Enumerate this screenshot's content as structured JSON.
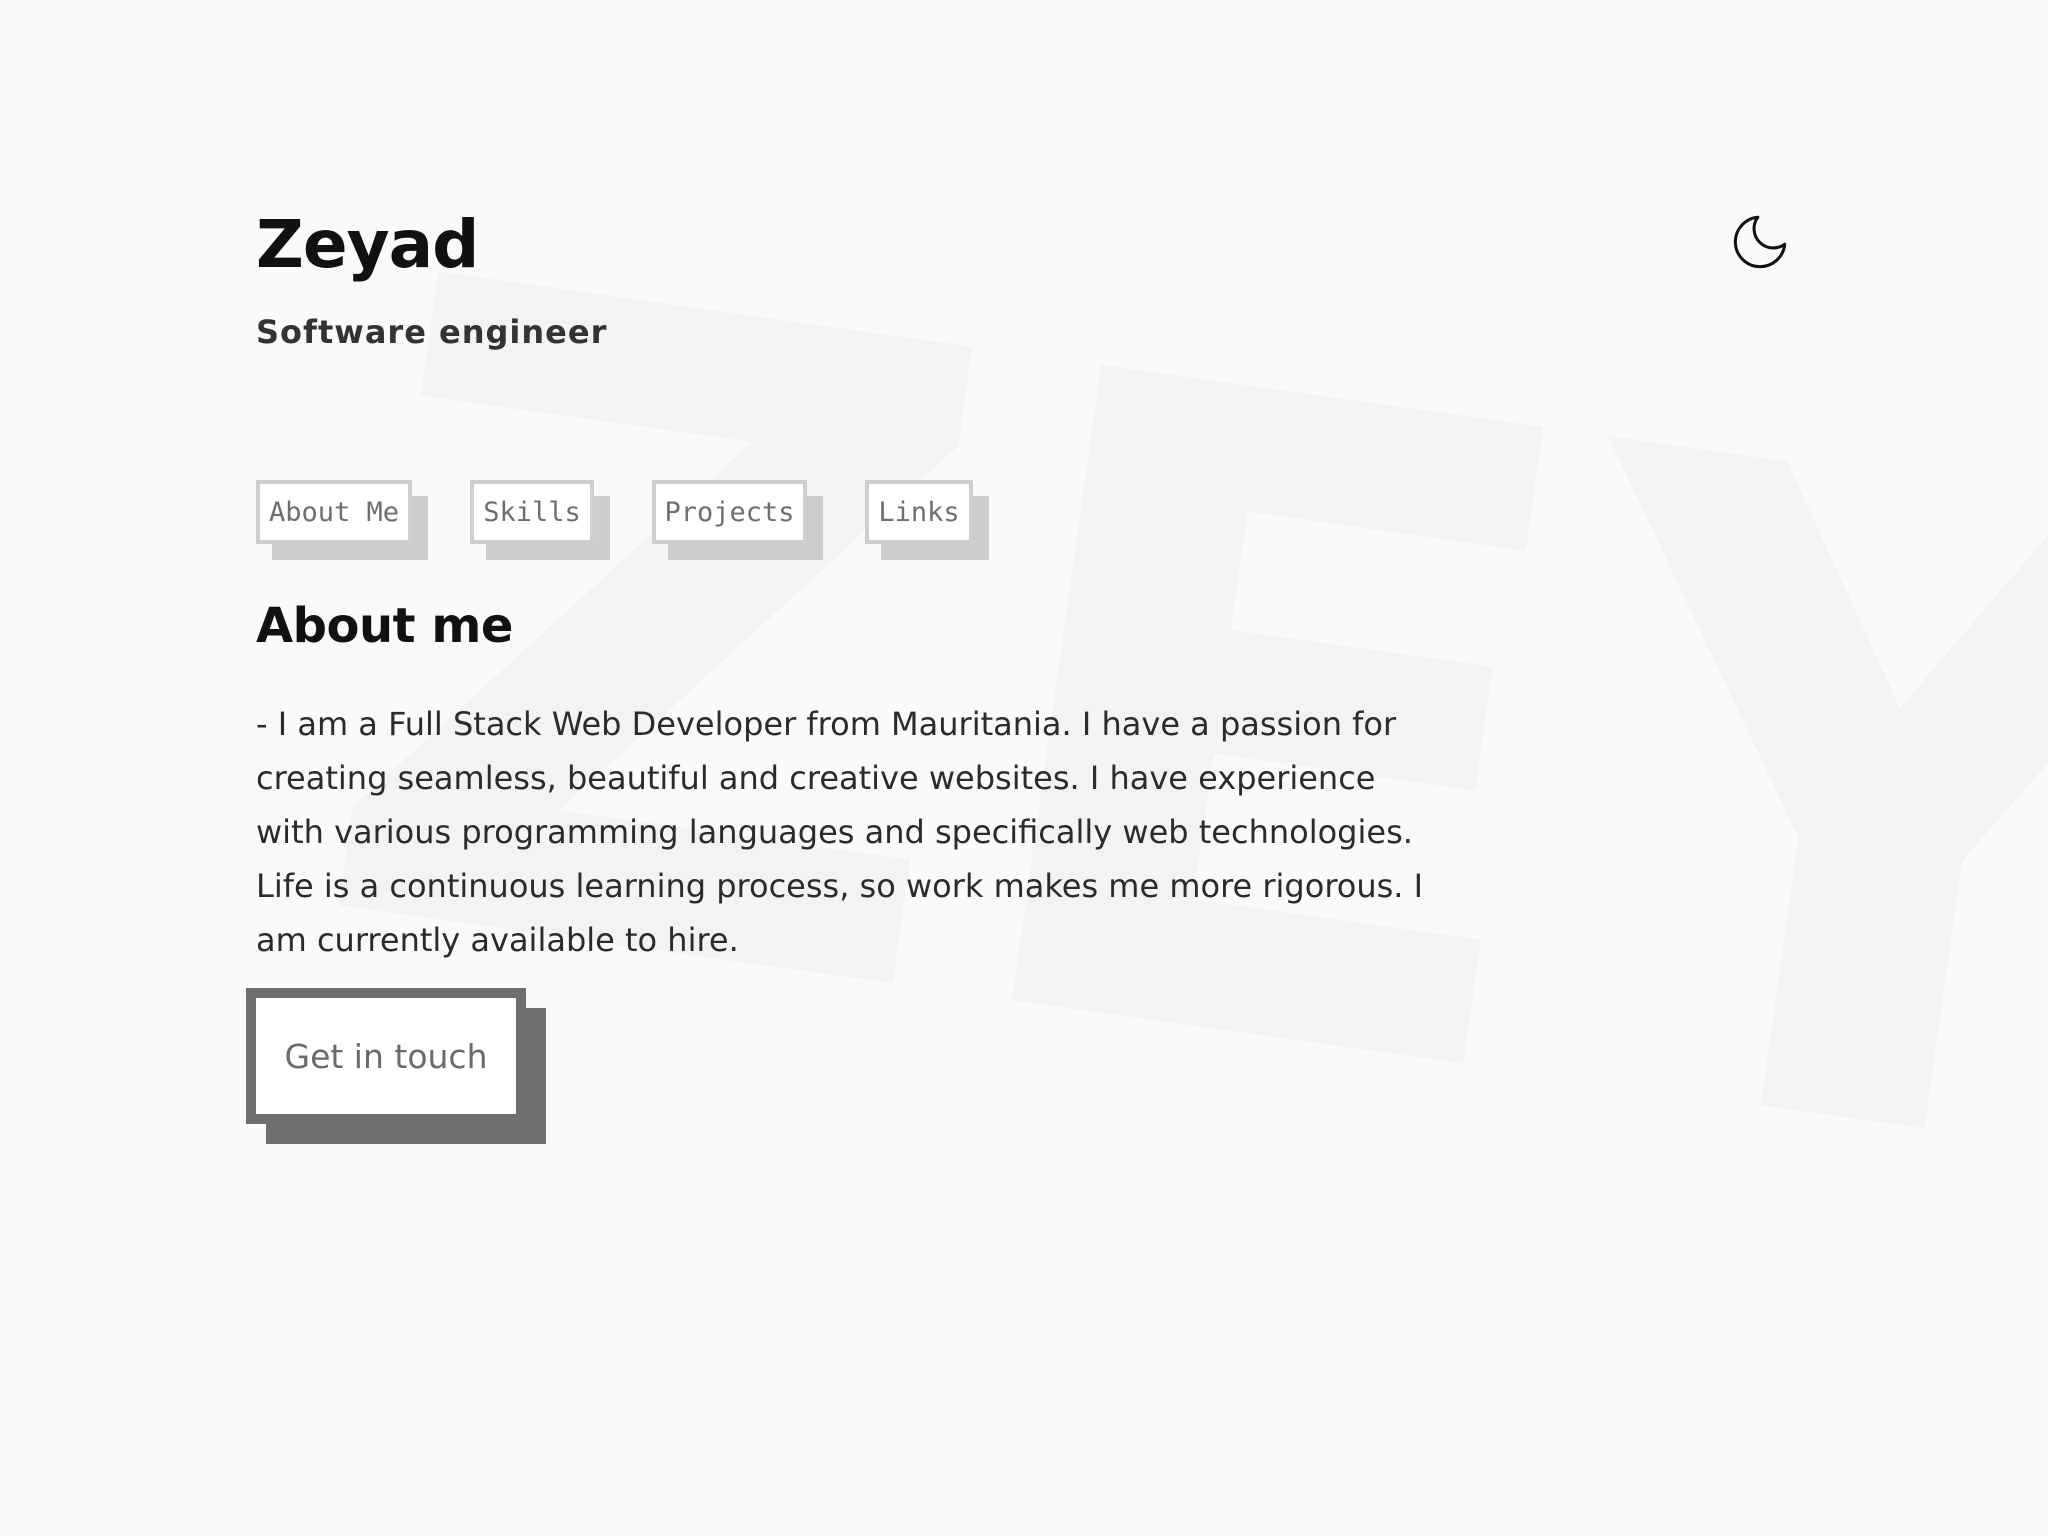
{
  "header": {
    "name": "Zeyad",
    "role": "Software engineer",
    "background_text": "ZEYAD"
  },
  "theme_toggle": {
    "icon": "moon-icon"
  },
  "nav": {
    "items": [
      {
        "label": "About Me"
      },
      {
        "label": "Skills"
      },
      {
        "label": "Projects"
      },
      {
        "label": "Links"
      }
    ]
  },
  "about": {
    "title": "About me",
    "text": "- I am a Full Stack Web Developer from Mauritania. I have a passion for creating seamless, beautiful and creative websites. I have experience with various programming languages and specifically web technologies. Life is a continuous learning process, so work makes me more rigorous. I am currently available to hire.",
    "cta_label": "Get in touch"
  },
  "colors": {
    "background": "#fafafa",
    "text": "#111111",
    "nav_border": "#cfcfcf",
    "cta_border": "#6f6f6f"
  }
}
